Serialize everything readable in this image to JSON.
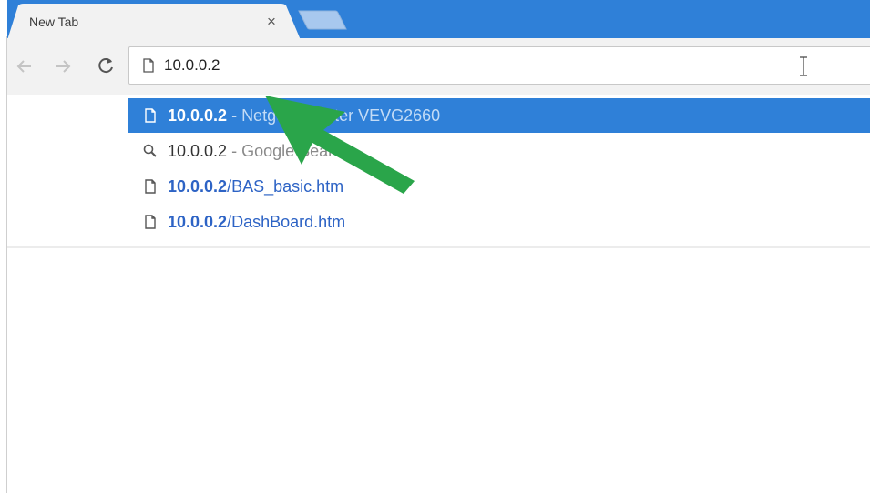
{
  "tab": {
    "title": "New Tab",
    "close_glyph": "×"
  },
  "omnibox": {
    "value": "10.0.0.2"
  },
  "suggestions": [
    {
      "icon": "page-icon",
      "main": "10.0.0.2",
      "sep": " - ",
      "desc": "Netgear Router VEVG2660",
      "selected": true
    },
    {
      "icon": "search-icon",
      "main": "10.0.0.2",
      "sep": " - ",
      "desc": "Google Search",
      "selected": false
    },
    {
      "icon": "page-icon",
      "main": "10.0.0.2",
      "rest": "/BAS_basic.htm",
      "selected": false
    },
    {
      "icon": "page-icon",
      "main": "10.0.0.2",
      "rest": "/DashBoard.htm",
      "selected": false
    }
  ],
  "colors": {
    "tabstrip": "#2f80d8",
    "selection": "#2f80d8",
    "arrow": "#2aa54a"
  }
}
